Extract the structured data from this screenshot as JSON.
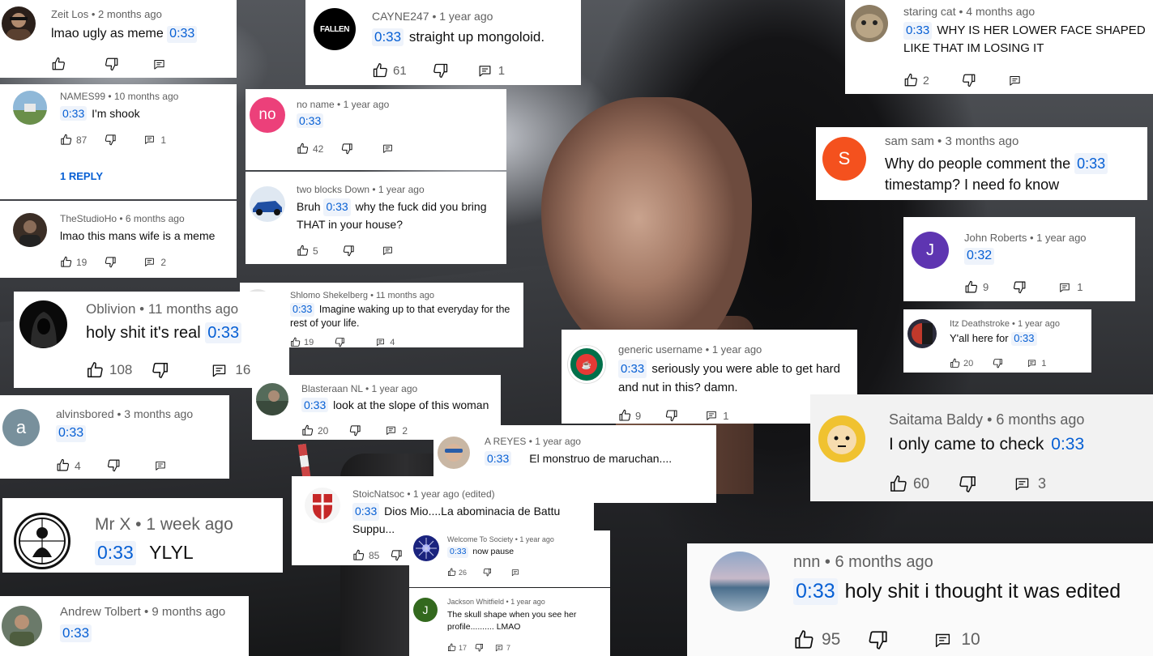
{
  "comments": [
    {
      "id": "zeit",
      "author": "Zeit Los",
      "age": "2 months ago",
      "timestamp": "0:33",
      "prefix": "lmao ugly as meme",
      "text": "",
      "likes": "",
      "replies": ""
    },
    {
      "id": "cayne",
      "author": "CAYNE247",
      "age": "1 year ago",
      "timestamp": "0:33",
      "prefix": "",
      "text": "straight up mongoloid.",
      "likes": "61",
      "replies": "1",
      "avatar_text": "FALLEN"
    },
    {
      "id": "staring",
      "author": "staring cat",
      "age": "4 months ago",
      "timestamp": "0:33",
      "prefix": "",
      "text": "WHY IS HER LOWER FACE SHAPED LIKE THAT IM LOSING IT",
      "likes": "2",
      "replies": ""
    },
    {
      "id": "names99",
      "author": "NAMES99",
      "age": "10 months ago",
      "timestamp": "0:33",
      "prefix": "",
      "text": "I'm shook",
      "likes": "87",
      "replies": "1",
      "reply_link": "1 REPLY"
    },
    {
      "id": "noname",
      "author": "no name",
      "age": "1 year ago",
      "timestamp": "0:33",
      "prefix": "",
      "text": "",
      "likes": "42",
      "replies": "",
      "avatar_text": "no"
    },
    {
      "id": "samsam",
      "author": "sam sam",
      "age": "3 months ago",
      "timestamp": "0:33",
      "prefix": "Why do people comment the",
      "text": "timestamp? I need fo know",
      "likes": "",
      "replies": "",
      "avatar_text": "S"
    },
    {
      "id": "twoblocks",
      "author": "two blocks Down",
      "age": "1 year ago",
      "timestamp": "0:33",
      "prefix": "Bruh",
      "text": "why the fuck did you bring THAT in your house?",
      "likes": "5",
      "replies": ""
    },
    {
      "id": "john",
      "author": "John Roberts",
      "age": "1 year ago",
      "timestamp": "0:32",
      "prefix": "",
      "text": "",
      "likes": "9",
      "replies": "1",
      "avatar_text": "J"
    },
    {
      "id": "studio",
      "author": "TheStudioHo",
      "age": "6 months ago",
      "timestamp": "",
      "prefix": "lmao this mans wife is a meme",
      "text": "",
      "likes": "19",
      "replies": "2"
    },
    {
      "id": "shlomo",
      "author": "Shlomo Shekelberg",
      "age": "11 months ago",
      "timestamp": "0:33",
      "prefix": "",
      "text": "Imagine waking up to that everyday for the rest of your life.",
      "likes": "19",
      "replies": "4"
    },
    {
      "id": "oblivion",
      "author": "Oblivion",
      "age": "11 months ago",
      "timestamp": "0:33",
      "prefix": "holy shit it's real",
      "text": "",
      "likes": "108",
      "replies": "16"
    },
    {
      "id": "itz",
      "author": "Itz Deathstroke",
      "age": "1 year ago",
      "timestamp": "0:33",
      "prefix": "Y'all here for",
      "text": "",
      "likes": "20",
      "replies": "1"
    },
    {
      "id": "generic",
      "author": "generic username",
      "age": "1 year ago",
      "timestamp": "0:33",
      "prefix": "",
      "text": "seriously you were able to get hard and nut in this? damn.",
      "likes": "9",
      "replies": "1",
      "avatar_text": "COFFEE"
    },
    {
      "id": "blaster",
      "author": "Blasteraan NL",
      "age": "1 year ago",
      "timestamp": "0:33",
      "prefix": "",
      "text": "look at the slope of this woman",
      "likes": "20",
      "replies": "2"
    },
    {
      "id": "alvins",
      "author": "alvinsbored",
      "age": "3 months ago",
      "timestamp": "0:33",
      "prefix": "",
      "text": "",
      "likes": "4",
      "replies": "",
      "avatar_text": "a"
    },
    {
      "id": "saitama",
      "author": "Saitama Baldy",
      "age": "6 months ago",
      "timestamp": "0:33",
      "prefix": "I only came to check",
      "text": "",
      "likes": "60",
      "replies": "3"
    },
    {
      "id": "areyes",
      "author": "A REYES",
      "age": "1 year ago",
      "timestamp": "0:33",
      "prefix": "",
      "text": "El monstruo de maruchan....",
      "likes": "",
      "replies": ""
    },
    {
      "id": "stoic",
      "author": "StoicNatsoc",
      "age": "1 year ago (edited)",
      "timestamp": "0:33",
      "prefix": "",
      "text": "Dios Mio....La abominacia de Battu Suppu...",
      "likes": "85",
      "replies": ""
    },
    {
      "id": "mrx",
      "author": "Mr X",
      "age": "1 week ago",
      "timestamp": "0:33",
      "prefix": "",
      "text": "YLYL",
      "likes": "",
      "replies": ""
    },
    {
      "id": "welcome",
      "author": "Welcome To Society",
      "age": "1 year ago",
      "timestamp": "0:33",
      "prefix": "",
      "text": "now pause",
      "likes": "26",
      "replies": ""
    },
    {
      "id": "jackson",
      "author": "Jackson Whitfield",
      "age": "1 year ago",
      "timestamp": "",
      "prefix": "The skull shape when you see her profile.......... LMAO",
      "text": "",
      "likes": "17",
      "replies": "7",
      "avatar_text": "J"
    },
    {
      "id": "nnn",
      "author": "nnn",
      "age": "6 months ago",
      "timestamp": "0:33",
      "prefix": "",
      "text": "holy shit i thought it was edited",
      "likes": "95",
      "replies": "10"
    },
    {
      "id": "andrew",
      "author": "Andrew Tolbert",
      "age": "9 months ago",
      "timestamp": "0:33",
      "prefix": "",
      "text": "",
      "likes": "",
      "replies": ""
    }
  ],
  "icons": {
    "like": "thumb-up-icon",
    "dislike": "thumb-down-icon",
    "reply": "reply-icon"
  },
  "colors": {
    "timestamp_bg": "#eef3fb",
    "timestamp_text": "#065fd4",
    "meta": "#606060",
    "noname_avatar": "#ec407a",
    "samsam_avatar": "#f4511e",
    "john_avatar": "#5e35b1",
    "alvins_avatar": "#78909c",
    "jackson_avatar": "#33691e"
  }
}
